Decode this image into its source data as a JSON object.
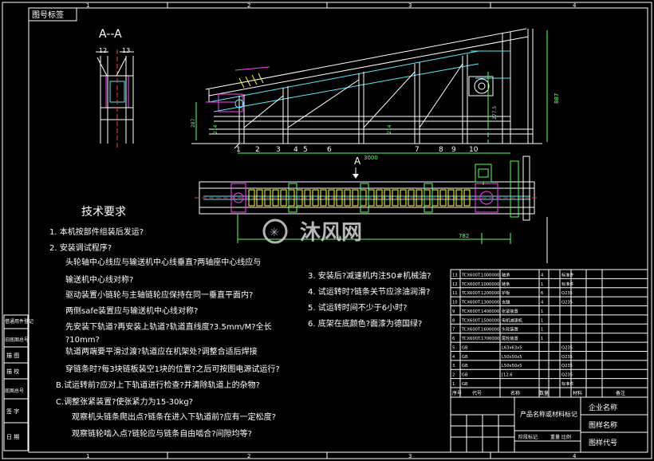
{
  "drawing": {
    "corner_label": "图号标签",
    "section_title": "A--A",
    "section_balloons": [
      "12",
      "13"
    ],
    "top_balloons": [
      "1",
      "2",
      "3",
      "4",
      "5",
      "6",
      "7",
      "8",
      "9",
      "10"
    ],
    "dims": {
      "width_3000": "3000",
      "width_782": "782",
      "height_887": "887",
      "height_2775": "277.5",
      "height_214": "214",
      "height_287": "287",
      "height_214b": "214"
    },
    "view_marker": "A",
    "frame_numbers": [
      "1",
      "2",
      "3",
      "4"
    ],
    "watermark": "沐风网"
  },
  "tech": {
    "title": "技术要求",
    "left": [
      "1.   本机按部件组装后发运?",
      "2.   安装调试程序?",
      "头轮轴中心线应与输送机中心线垂直?两轴座中心线应与",
      "输送机中心线对称?",
      "驱动装置小链轮与主轴链轮应保持在同一垂直平面内?",
      "两侧safe装置应与输送机中心线对称?",
      "先安装下轨道?再安装上轨道?轨道直线度?3.5mm/M?全长",
      "?10mm?",
      "轨道两端要平滑过渡?轨道应在机架处?调整合适后焊接",
      "穿链条时?每3块链板装空1块的位置?之后可按图电源试运行?",
      "B.试运转前?应对上下轨道进行检查?并清除轨道上的杂物?",
      "C.调整张紧装置?使张紧力为15-30kg?",
      "观察机头链条爬出点?链条在进入下轨道前?应有一定松度?",
      "观察链轮啮入点?链轮应与链条自由啮合?间隙均等?"
    ],
    "right": [
      "3.   安装后?减速机内注50#机械油?",
      "4.   试运转时?链条关节应涂油润滑?",
      "5.   试运转时间不少于6小时?",
      "6.  底架在底颜色?面漆为德国绿?"
    ]
  },
  "bom": {
    "rows": [
      {
        "no": "13",
        "code": "TCX600T.1000000",
        "name": "轴承",
        "qty": "4",
        "mat": "标准件"
      },
      {
        "no": "12",
        "code": "TCX600T.1000000",
        "name": "链条",
        "qty": "1",
        "mat": "标准件"
      },
      {
        "no": "11",
        "code": "TCX600T.1200000",
        "name": "护板",
        "qty": "6",
        "mat": "Q235"
      },
      {
        "no": "10",
        "code": "TCX600T.1300000",
        "name": "支腿",
        "qty": "4",
        "mat": "Q235"
      },
      {
        "no": "9",
        "code": "TCX600T.1400000",
        "name": "张紧装置",
        "qty": "1",
        "mat": ""
      },
      {
        "no": "8",
        "code": "TCX600T.1500000",
        "name": "电机减速机",
        "qty": "1",
        "mat": ""
      },
      {
        "no": "7",
        "code": "TCX600T.1600000",
        "name": "头轮装置",
        "qty": "1",
        "mat": ""
      },
      {
        "no": "6",
        "code": "TCX600T.1700000",
        "name": "尾轮装置",
        "qty": "1",
        "mat": ""
      },
      {
        "no": "5",
        "code": "GB",
        "name": "L63x63x5",
        "qty": "",
        "mat": "Q235"
      },
      {
        "no": "4",
        "code": "GB",
        "name": "L50x50x5",
        "qty": "",
        "mat": "Q235"
      },
      {
        "no": "3",
        "code": "GB",
        "name": "L50x50x5",
        "qty": "",
        "mat": "Q235"
      },
      {
        "no": "2",
        "code": "GB",
        "name": "[12.6",
        "qty": "",
        "mat": "Q235"
      },
      {
        "no": "1",
        "code": "GB",
        "name": "",
        "qty": "",
        "mat": "标准件"
      }
    ],
    "header": [
      "序号",
      "代号",
      "名称",
      "数量",
      "材料",
      "备注"
    ]
  },
  "title_block": {
    "product_label": "产品名称或材料标记",
    "company": "企业名称",
    "drawing_name": "图样名称",
    "drawing_code": "图样代号",
    "scale_label": "重量 比例",
    "stage_label": "阶段标记"
  },
  "side_strip": [
    "借通用件登记",
    "旧底图总号",
    "描 图",
    "描 校",
    "底图总号",
    "签 字",
    "日 期"
  ]
}
